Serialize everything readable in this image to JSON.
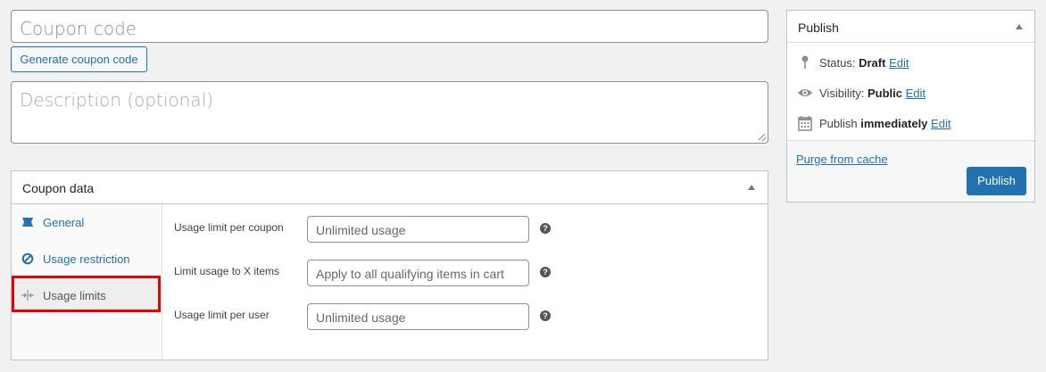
{
  "coupon": {
    "code_placeholder": "Coupon code",
    "generate_label": "Generate coupon code",
    "description_placeholder": "Description (optional)"
  },
  "coupon_data": {
    "title": "Coupon data",
    "tabs": [
      {
        "label": "General",
        "icon": "ticket-icon"
      },
      {
        "label": "Usage restriction",
        "icon": "block-icon"
      },
      {
        "label": "Usage limits",
        "icon": "arrows-in-icon"
      }
    ],
    "active_tab": "Usage limits",
    "fields": [
      {
        "label": "Usage limit per coupon",
        "placeholder": "Unlimited usage"
      },
      {
        "label": "Limit usage to X items",
        "placeholder": "Apply to all qualifying items in cart"
      },
      {
        "label": "Usage limit per user",
        "placeholder": "Unlimited usage"
      }
    ],
    "help_glyph": "?"
  },
  "publish": {
    "title": "Publish",
    "status_prefix": "Status:",
    "status_value": "Draft",
    "visibility_prefix": "Visibility:",
    "visibility_value": "Public",
    "publish_prefix": "Publish",
    "publish_value": "immediately",
    "edit_label": "Edit",
    "purge_label": "Purge from cache",
    "button_label": "Publish"
  },
  "colors": {
    "accent": "#2271b1",
    "highlight": "#ee0000"
  }
}
